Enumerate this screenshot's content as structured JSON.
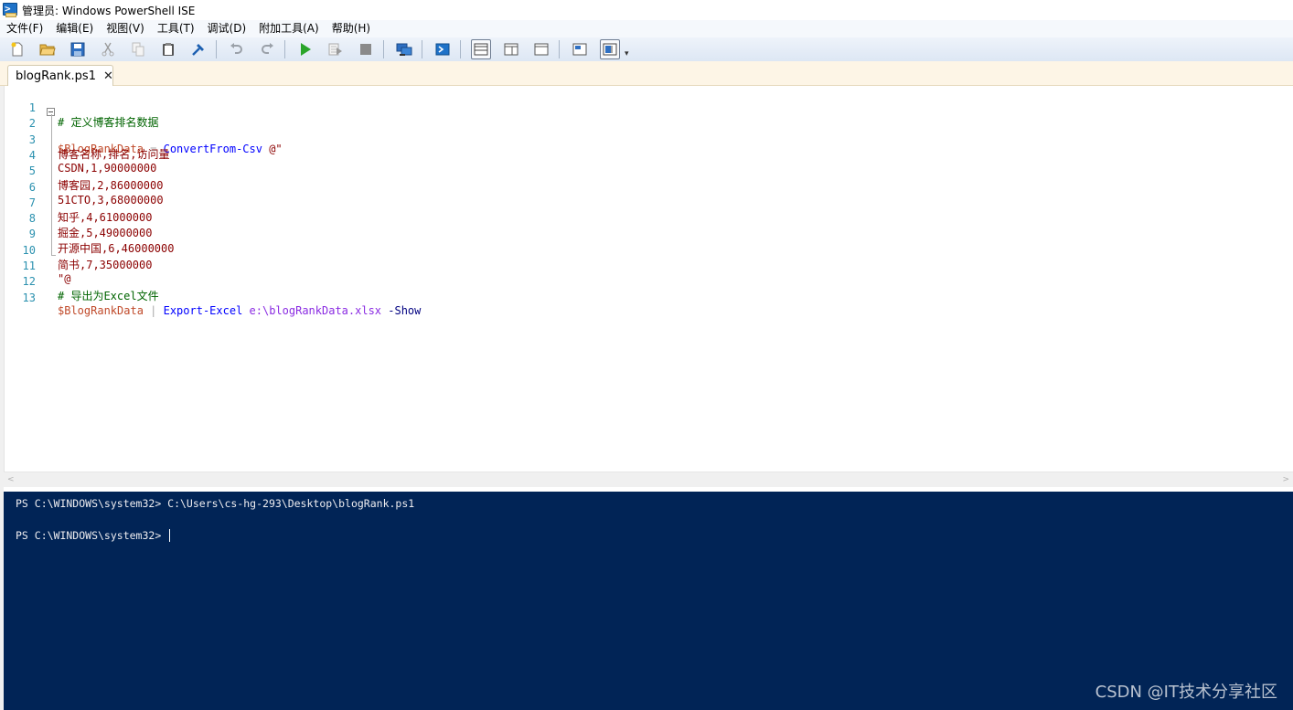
{
  "window": {
    "title": "管理员: Windows PowerShell ISE"
  },
  "menu": {
    "items": [
      "文件(F)",
      "编辑(E)",
      "视图(V)",
      "工具(T)",
      "调试(D)",
      "附加工具(A)",
      "帮助(H)"
    ]
  },
  "toolbar": {
    "buttons": [
      {
        "icon": "new-file-icon"
      },
      {
        "icon": "open-folder-icon"
      },
      {
        "icon": "save-icon"
      },
      {
        "icon": "cut-icon"
      },
      {
        "icon": "copy-icon"
      },
      {
        "icon": "paste-icon"
      },
      {
        "icon": "clear-console-icon"
      },
      {
        "icon": "undo-icon"
      },
      {
        "icon": "redo-icon"
      },
      {
        "icon": "run-script-icon"
      },
      {
        "icon": "run-selection-icon"
      },
      {
        "icon": "stop-icon"
      },
      {
        "icon": "remote-powershell-icon"
      },
      {
        "icon": "start-powershell-icon"
      },
      {
        "icon": "script-pane-top-icon"
      },
      {
        "icon": "script-pane-right-icon"
      },
      {
        "icon": "script-pane-maximized-icon"
      },
      {
        "icon": "show-script-pane-icon"
      },
      {
        "icon": "show-command-addon-icon"
      }
    ]
  },
  "tab": {
    "label": "blogRank.ps1",
    "close": "✕"
  },
  "editor": {
    "lines": [
      {
        "n": "1",
        "text": "# 定义博客排名数据"
      },
      {
        "n": "2",
        "var": "$BlogRankData",
        "eq": " = ",
        "cmd": "ConvertFrom-Csv",
        "rest": " @\""
      },
      {
        "n": "3",
        "text": "博客名称,排名,访问量"
      },
      {
        "n": "4",
        "text": "CSDN,1,90000000"
      },
      {
        "n": "5",
        "text": "博客园,2,86000000"
      },
      {
        "n": "6",
        "text": "51CTO,3,68000000"
      },
      {
        "n": "7",
        "text": "知乎,4,61000000"
      },
      {
        "n": "8",
        "text": "掘金,5,49000000"
      },
      {
        "n": "9",
        "text": "开源中国,6,46000000"
      },
      {
        "n": "10",
        "text": "简书,7,35000000"
      },
      {
        "n": "11",
        "text": "\"@"
      },
      {
        "n": "12",
        "text": "# 导出为Excel文件"
      },
      {
        "n": "13",
        "var": "$BlogRankData",
        "pipe": " | ",
        "cmd": "Export-Excel",
        "path": " e:\\blogRankData.xlsx",
        "param": " -Show"
      }
    ]
  },
  "console": {
    "line1": "PS C:\\WINDOWS\\system32> C:\\Users\\cs-hg-293\\Desktop\\blogRank.ps1",
    "line2": "PS C:\\WINDOWS\\system32> "
  },
  "watermark": "CSDN @IT技术分享社区",
  "colors": {
    "console_bg": "#012456",
    "comment": "#006400",
    "string": "#8b0000",
    "command": "#0000ff",
    "line_number": "#2b91af"
  }
}
